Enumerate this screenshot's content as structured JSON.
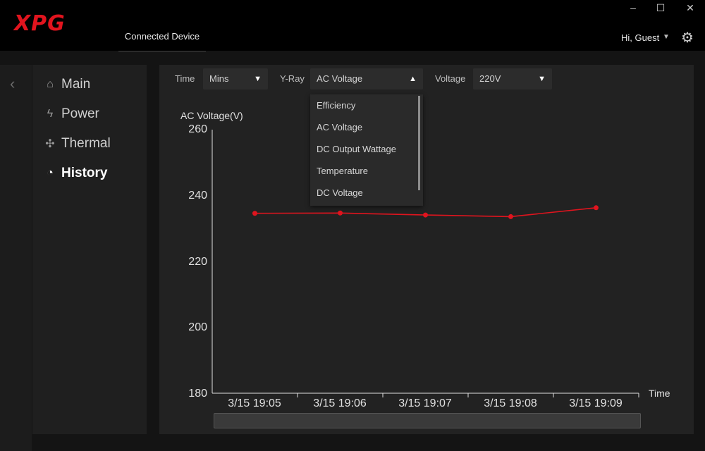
{
  "app": {
    "logo": "XPG",
    "tab": "Connected Device",
    "user": "Hi, Guest"
  },
  "window": {
    "minimize": "–",
    "maximize": "☐",
    "close": "✕"
  },
  "icons": {
    "back": "chevron-left-icon",
    "gear": "gear-icon",
    "main": "home-icon",
    "power": "lightning-icon",
    "thermal": "fan-icon",
    "history": "clock-icon"
  },
  "sidebar": {
    "items": [
      {
        "label": "Main",
        "icon": "⌂"
      },
      {
        "label": "Power",
        "icon": "ϟ"
      },
      {
        "label": "Thermal",
        "icon": "✣"
      },
      {
        "label": "History",
        "icon": "◔",
        "active": true
      }
    ]
  },
  "controls": {
    "time": {
      "label": "Time",
      "value": "Mins"
    },
    "yray": {
      "label": "Y-Ray",
      "value": "AC Voltage",
      "open": true,
      "options": [
        "Efficiency",
        "AC Voltage",
        "DC Output Wattage",
        "Temperature",
        "DC Voltage"
      ]
    },
    "voltage": {
      "label": "Voltage",
      "value": "220V"
    }
  },
  "colors": {
    "accent": "#e1141e",
    "line": "#e0141e"
  },
  "chart_data": {
    "type": "line",
    "ylabel": "AC Voltage(V)",
    "xlabel": "Time",
    "yticks": [
      "260",
      "240",
      "220",
      "200",
      "180"
    ],
    "ylim": [
      180,
      260
    ],
    "categories": [
      "3/15 19:05",
      "3/15 19:06",
      "3/15 19:07",
      "3/15 19:08",
      "3/15 19:09"
    ],
    "values": [
      234.6,
      234.7,
      234.1,
      233.6,
      236.3
    ]
  }
}
